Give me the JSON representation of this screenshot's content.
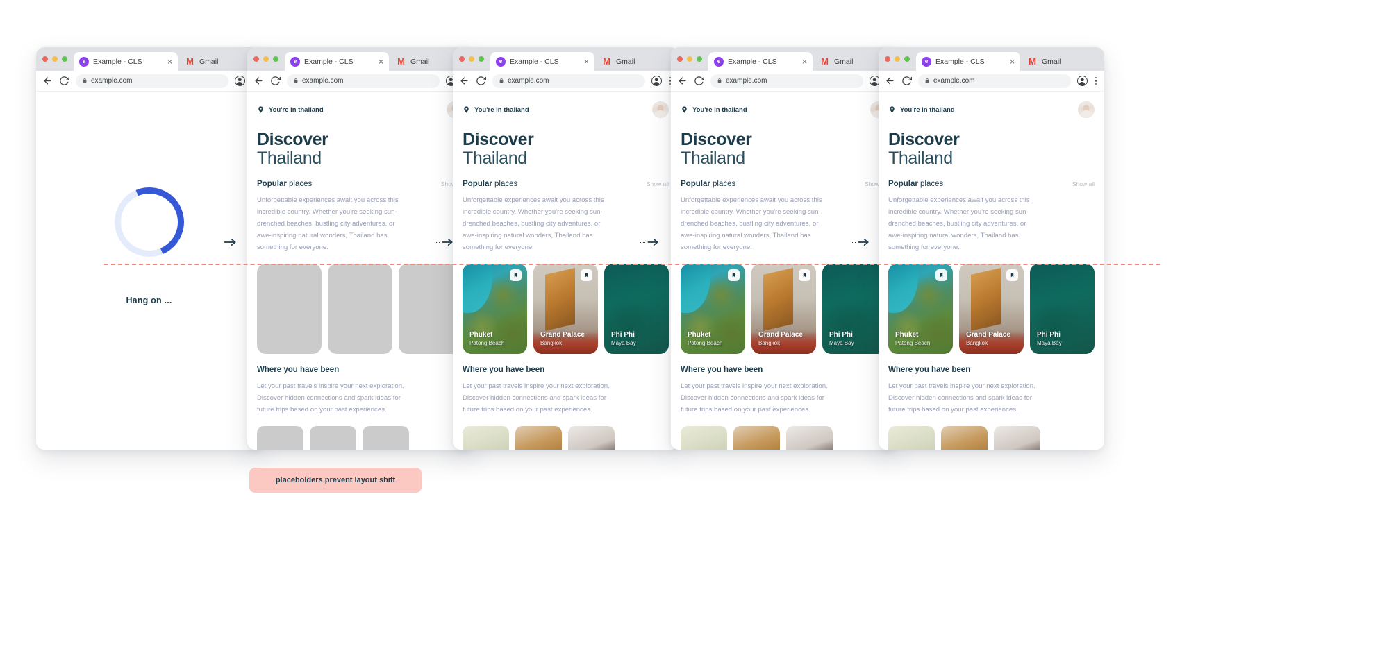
{
  "browser": {
    "tab_title": "Example - CLS",
    "tab_title_2": "Gmail",
    "url": "example.com",
    "close_label": "×",
    "icons": {
      "back": "back-arrow-icon",
      "forward": "forward-arrow-icon",
      "reload": "reload-icon",
      "lock": "lock-icon",
      "profile": "profile-icon",
      "menu": "kebab-menu-icon",
      "favicon": "e",
      "gmail_favicon": "M"
    }
  },
  "loading": {
    "message": "Hang on ..."
  },
  "app": {
    "location_text": "You're in thailand",
    "title_line1": "Discover",
    "title_line2": "Thailand",
    "section_title_bold": "Popular",
    "section_title_rest": " places",
    "show_all": "Show all",
    "blurb": "Unforgettable experiences await you across this incredible country. Whether you're seeking sun-drenched beaches, bustling city adventures, or awe-inspiring natural wonders, Thailand has something for everyone.",
    "cards": [
      {
        "name": "Phuket",
        "sub": "Patong Beach"
      },
      {
        "name": "Grand Palace",
        "sub": "Bangkok"
      },
      {
        "name": "Phi Phi",
        "sub": "Maya Bay"
      }
    ],
    "history_title": "Where you have been",
    "history_body": "Let your past travels inspire your next exploration. Discover hidden connections and spark ideas for future trips based on your past experiences."
  },
  "annotation": {
    "badge_label": "placeholders prevent layout shift",
    "badge_color": "#fbc9c2",
    "line_color": "#f08a7d",
    "arrow_label": "sequence-arrow"
  }
}
